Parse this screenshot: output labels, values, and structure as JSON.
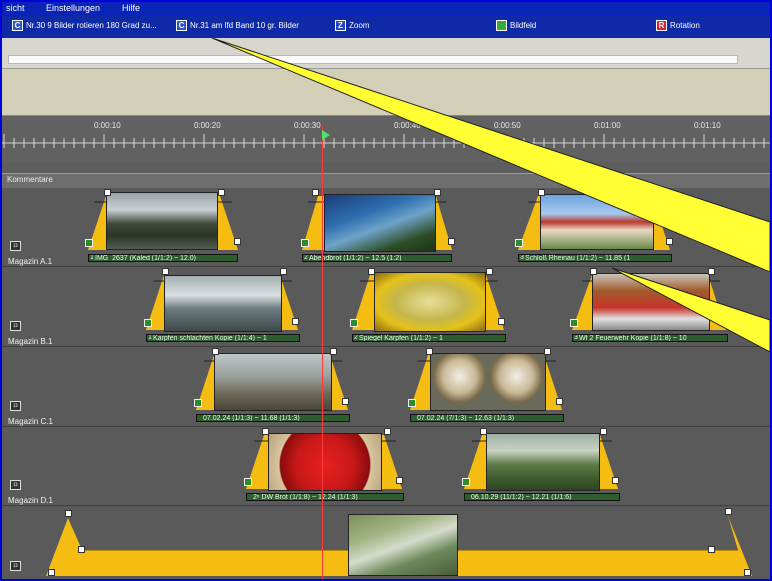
{
  "menu": {
    "items": [
      "sicht",
      "Einstellungen",
      "Hilfe"
    ]
  },
  "toolbar": {
    "effects": [
      {
        "icon_text": "C",
        "label": "Nr.30  9 Bilder rotieren 180 Grad zu..."
      },
      {
        "icon_text": "C",
        "label": "Nr.31 am lfd Band 10 gr. Bilder"
      },
      {
        "icon_text": "Z",
        "label": "Zoom"
      },
      {
        "icon_text": "",
        "label": "Bildfeld"
      },
      {
        "icon_text": "R",
        "label": "Rotation"
      }
    ]
  },
  "ruler": {
    "times": [
      "0:00:10",
      "0:00:20",
      "0:00:30",
      "0:00:40",
      "0:00:50",
      "0:01:00",
      "0:01:10"
    ]
  },
  "comments_lane": {
    "label": "Kommentare"
  },
  "tracks": [
    {
      "label": "Magazin A.1",
      "clips": [
        {
          "num": "1",
          "caption": "IMG_2637 (Kaled (1/1:2) ~ 12.0)"
        },
        {
          "num": "2",
          "caption": "Abendbrot (1/1:2) ~ 12.5 (1:2)"
        },
        {
          "num": "3",
          "caption": "Schloß Rheinau (1/1:2) ~ 11.85 (1"
        }
      ]
    },
    {
      "label": "Magazin B.1",
      "clips": [
        {
          "num": "1",
          "caption": "Karpfen schlachten Kopie (1/1:4) ~ 1"
        },
        {
          "num": "2",
          "caption": "Spiegel Karpfen (1/1:2) ~ 1"
        },
        {
          "num": "3",
          "caption": "Wf 2 Feuerwehr Kopie (1/1:8) ~ 10"
        }
      ]
    },
    {
      "label": "Magazin C.1",
      "clips": [
        {
          "num": "",
          "caption": "07.02.24 (1/1:3) ~ 11.68 (1/1:3)"
        },
        {
          "num": "",
          "caption": "07.02.24 (7/1:3) ~ 12.63 (1/1:3)"
        }
      ]
    },
    {
      "label": "Magazin D.1",
      "clips": [
        {
          "num": "",
          "caption": "2ⁿ DW Brot (1/1:8) ~ 12.24 (1/1:3)"
        },
        {
          "num": "",
          "caption": "06.10.29 (11/1:2) ~ 12.21 (1/1:6)"
        }
      ]
    },
    {
      "label": "",
      "clips": [
        {
          "num": "",
          "caption": ""
        }
      ]
    }
  ],
  "colors": {
    "menubar": "#0a24b8",
    "envelope": "#f5bd12",
    "clip_bar": "#2e5d2e",
    "playhead": "#ff3b3b",
    "callout": "#ffff33"
  }
}
